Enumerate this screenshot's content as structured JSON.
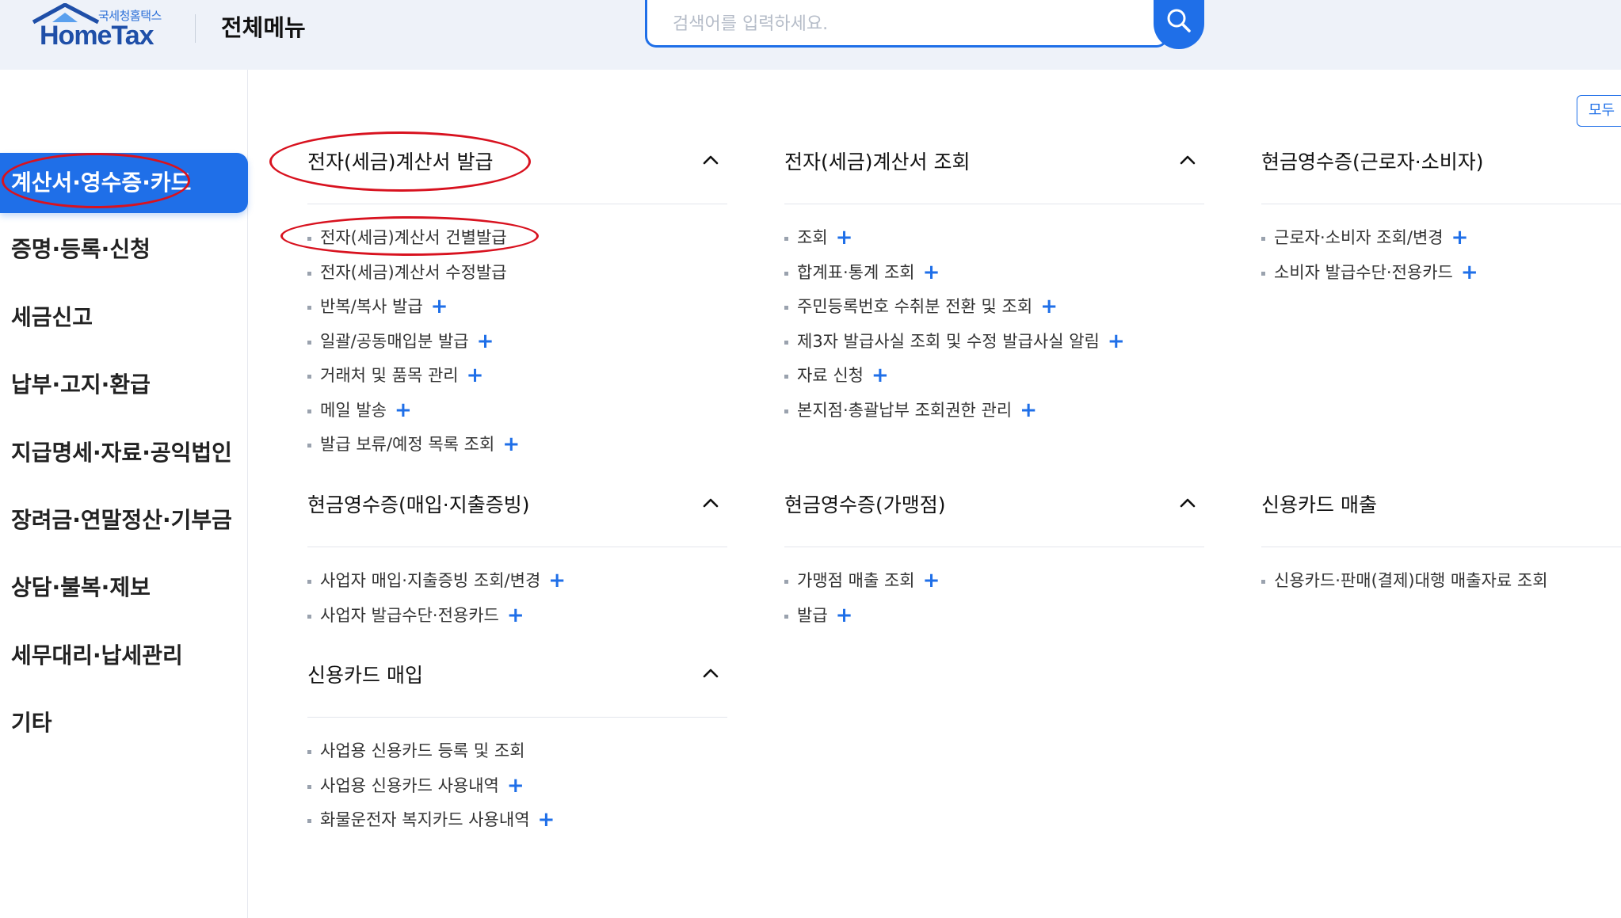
{
  "header": {
    "logo_small": "국세청홈택스",
    "logo_main": "HomeTax",
    "page_title": "전체메뉴",
    "search_placeholder": "검색어를 입력하세요."
  },
  "toggle_all_label": "모두",
  "sidebar": {
    "items": [
      {
        "label": "계산서·영수증·카드",
        "active": true
      },
      {
        "label": "증명·등록·신청"
      },
      {
        "label": "세금신고"
      },
      {
        "label": "납부·고지·환급"
      },
      {
        "label": "지급명세·자료·공익법인"
      },
      {
        "label": "장려금·연말정산·기부금"
      },
      {
        "label": "상담·불복·제보"
      },
      {
        "label": "세무대리·납세관리"
      },
      {
        "label": "기타"
      }
    ]
  },
  "sections": [
    {
      "title": "전자(세금)계산서 발급",
      "items": [
        {
          "label": "전자(세금)계산서 건별발급",
          "plus": false
        },
        {
          "label": "전자(세금)계산서 수정발급",
          "plus": false
        },
        {
          "label": "반복/복사 발급",
          "plus": true
        },
        {
          "label": "일괄/공동매입분 발급",
          "plus": true
        },
        {
          "label": "거래처 및 품목 관리",
          "plus": true
        },
        {
          "label": "메일 발송",
          "plus": true
        },
        {
          "label": "발급 보류/예정 목록 조회",
          "plus": true
        }
      ]
    },
    {
      "title": "전자(세금)계산서 조회",
      "items": [
        {
          "label": "조회",
          "plus": true
        },
        {
          "label": "합계표·통계 조회",
          "plus": true
        },
        {
          "label": "주민등록번호 수취분 전환 및 조회",
          "plus": true
        },
        {
          "label": "제3자 발급사실 조회 및 수정 발급사실 알림",
          "plus": true
        },
        {
          "label": "자료 신청",
          "plus": true
        },
        {
          "label": "본지점·총괄납부 조회권한 관리",
          "plus": true
        }
      ]
    },
    {
      "title": "현금영수증(근로자·소비자)",
      "items": [
        {
          "label": "근로자·소비자 조회/변경",
          "plus": true
        },
        {
          "label": "소비자 발급수단·전용카드",
          "plus": true
        }
      ]
    },
    {
      "title": "현금영수증(매입·지출증빙)",
      "items": [
        {
          "label": "사업자 매입·지출증빙 조회/변경",
          "plus": true
        },
        {
          "label": "사업자 발급수단·전용카드",
          "plus": true
        }
      ]
    },
    {
      "title": "현금영수증(가맹점)",
      "items": [
        {
          "label": "가맹점 매출 조회",
          "plus": true
        },
        {
          "label": "발급",
          "plus": true
        }
      ]
    },
    {
      "title": "신용카드 매출",
      "items": [
        {
          "label": "신용카드·판매(결제)대행 매출자료 조회",
          "plus": false
        }
      ]
    },
    {
      "title": "신용카드 매입",
      "items": [
        {
          "label": "사업용 신용카드 등록 및 조회",
          "plus": false
        },
        {
          "label": "사업용 신용카드 사용내역",
          "plus": true
        },
        {
          "label": "화물운전자 복지카드 사용내역",
          "plus": true
        }
      ]
    }
  ],
  "colors": {
    "accent": "#1f6fe8",
    "highlight": "#d8121f"
  }
}
